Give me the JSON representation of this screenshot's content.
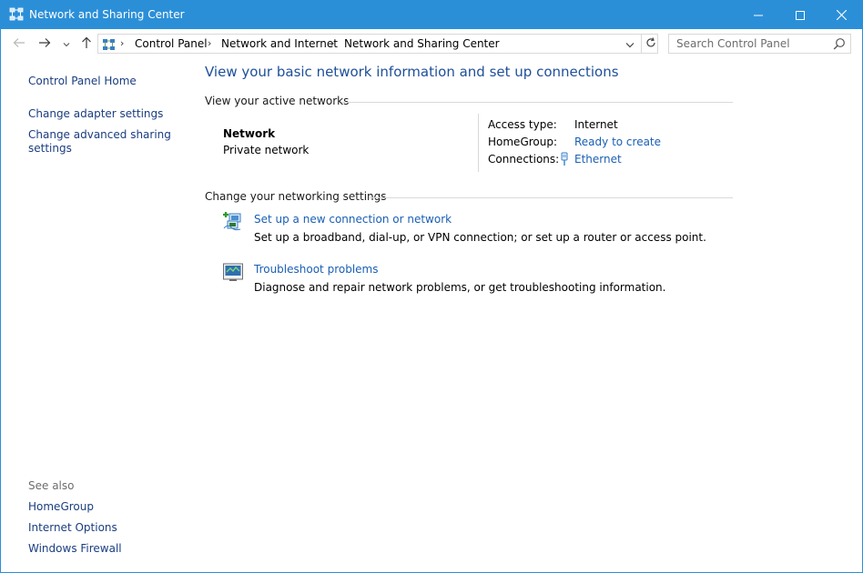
{
  "window": {
    "title": "Network and Sharing Center",
    "accent": "#2b8fd8"
  },
  "nav": {
    "breadcrumbs": [
      "Control Panel",
      "Network and Internet",
      "Network and Sharing Center"
    ],
    "search_placeholder": "Search Control Panel"
  },
  "sidebar": {
    "links": [
      "Control Panel Home",
      "Change adapter settings",
      "Change advanced sharing settings"
    ],
    "see_also_label": "See also",
    "see_also": [
      "HomeGroup",
      "Internet Options",
      "Windows Firewall"
    ]
  },
  "main": {
    "title": "View your basic network information and set up connections",
    "active_networks": {
      "header": "View your active networks",
      "network_name": "Network",
      "network_type": "Private network",
      "access_type_label": "Access type:",
      "access_type_value": "Internet",
      "homegroup_label": "HomeGroup:",
      "homegroup_value": "Ready to create",
      "connections_label": "Connections:",
      "connections_value": "Ethernet"
    },
    "settings": {
      "header": "Change your networking settings",
      "tasks": [
        {
          "label": "Set up a new connection or network",
          "description": "Set up a broadband, dial-up, or VPN connection; or set up a router or access point."
        },
        {
          "label": "Troubleshoot problems",
          "description": "Diagnose and repair network problems, or get troubleshooting information."
        }
      ]
    }
  }
}
